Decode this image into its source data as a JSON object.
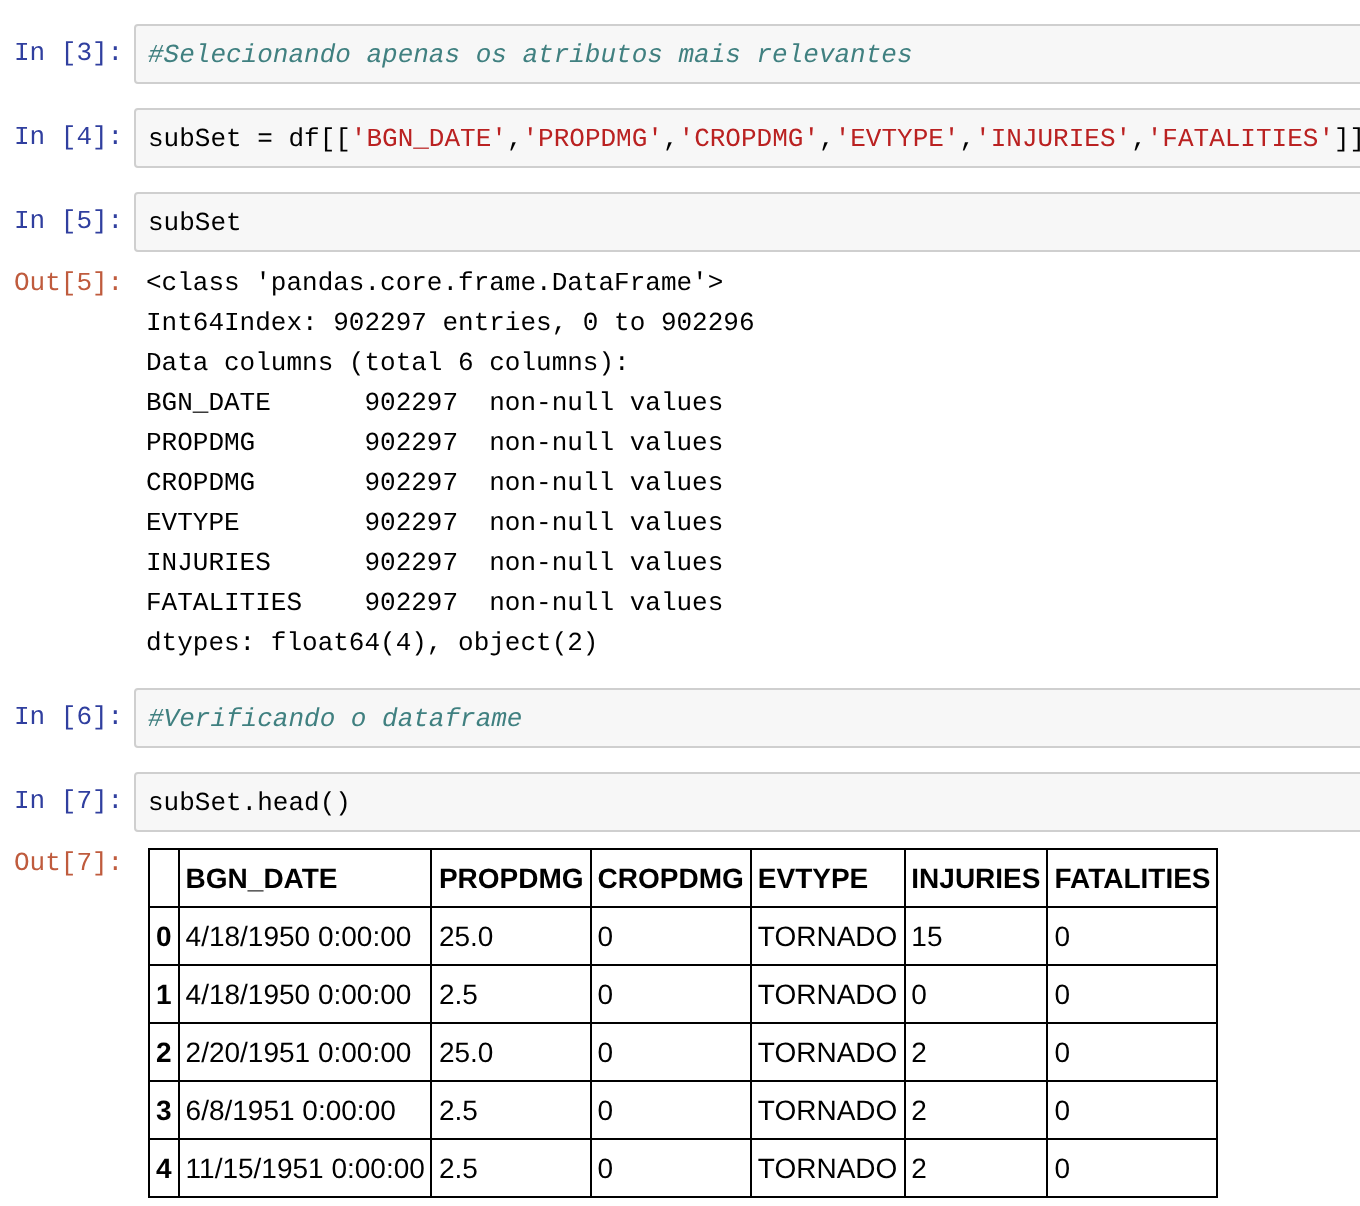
{
  "cells": [
    {
      "prompt": "In [3]:",
      "input": [
        {
          "text": "#Selecionando apenas os atributos mais relevantes",
          "kind": "comment"
        }
      ]
    },
    {
      "prompt": "In [4]:",
      "input": [
        {
          "text": "subSet = df[[",
          "kind": "plain"
        },
        {
          "text": "'BGN_DATE'",
          "kind": "string"
        },
        {
          "text": ",",
          "kind": "plain"
        },
        {
          "text": "'PROPDMG'",
          "kind": "string"
        },
        {
          "text": ",",
          "kind": "plain"
        },
        {
          "text": "'CROPDMG'",
          "kind": "string"
        },
        {
          "text": ",",
          "kind": "plain"
        },
        {
          "text": "'EVTYPE'",
          "kind": "string"
        },
        {
          "text": ",",
          "kind": "plain"
        },
        {
          "text": "'INJURIES'",
          "kind": "string"
        },
        {
          "text": ",",
          "kind": "plain"
        },
        {
          "text": "'FATALITIES'",
          "kind": "string"
        },
        {
          "text": "]]",
          "kind": "plain"
        }
      ]
    },
    {
      "prompt": "In [5]:",
      "input": [
        {
          "text": "subSet",
          "kind": "plain"
        }
      ],
      "output": {
        "prompt": "Out[5]:",
        "kind": "text",
        "lines": [
          "<class 'pandas.core.frame.DataFrame'>",
          "Int64Index: 902297 entries, 0 to 902296",
          "Data columns (total 6 columns):",
          "BGN_DATE      902297  non-null values",
          "PROPDMG       902297  non-null values",
          "CROPDMG       902297  non-null values",
          "EVTYPE        902297  non-null values",
          "INJURIES      902297  non-null values",
          "FATALITIES    902297  non-null values",
          "dtypes: float64(4), object(2)"
        ]
      }
    },
    {
      "prompt": "In [6]:",
      "input": [
        {
          "text": "#Verificando o dataframe",
          "kind": "comment"
        }
      ]
    },
    {
      "prompt": "In [7]:",
      "input": [
        {
          "text": "subSet.head()",
          "kind": "plain"
        }
      ],
      "output": {
        "prompt": "Out[7]:",
        "kind": "table",
        "columns": [
          "BGN_DATE",
          "PROPDMG",
          "CROPDMG",
          "EVTYPE",
          "INJURIES",
          "FATALITIES"
        ],
        "rows": [
          {
            "index": "0",
            "values": [
              "4/18/1950 0:00:00",
              "25.0",
              "0",
              "TORNADO",
              "15",
              "0"
            ]
          },
          {
            "index": "1",
            "values": [
              "4/18/1950 0:00:00",
              "2.5",
              "0",
              "TORNADO",
              "0",
              "0"
            ]
          },
          {
            "index": "2",
            "values": [
              "2/20/1951 0:00:00",
              "25.0",
              "0",
              "TORNADO",
              "2",
              "0"
            ]
          },
          {
            "index": "3",
            "values": [
              "6/8/1951 0:00:00",
              "2.5",
              "0",
              "TORNADO",
              "2",
              "0"
            ]
          },
          {
            "index": "4",
            "values": [
              "11/15/1951 0:00:00",
              "2.5",
              "0",
              "TORNADO",
              "2",
              "0"
            ]
          }
        ]
      }
    }
  ]
}
